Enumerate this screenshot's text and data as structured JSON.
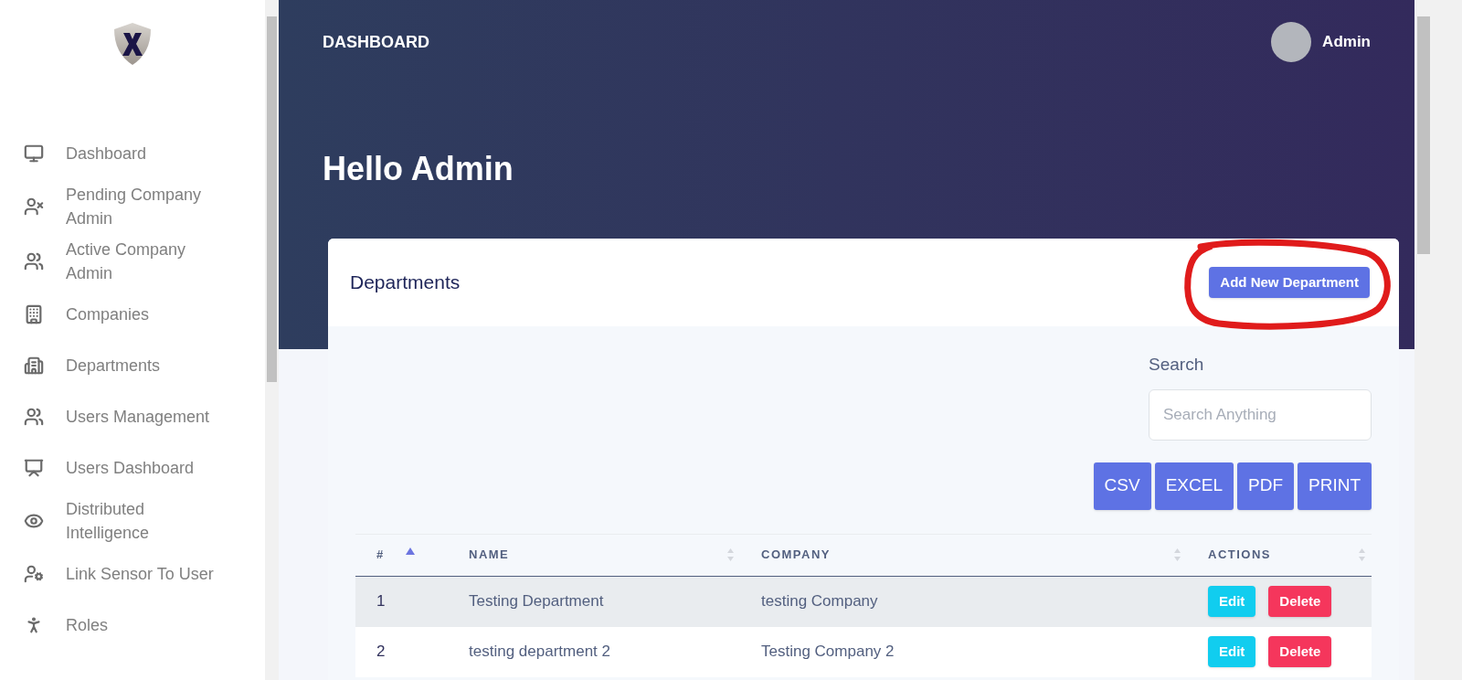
{
  "sidebar": {
    "items": [
      {
        "label": "Dashboard"
      },
      {
        "label": "Pending Company Admin"
      },
      {
        "label": "Active Company Admin"
      },
      {
        "label": "Companies"
      },
      {
        "label": "Departments"
      },
      {
        "label": "Users Management"
      },
      {
        "label": "Users Dashboard"
      },
      {
        "label": "Distributed Intelligence"
      },
      {
        "label": "Link Sensor To User"
      },
      {
        "label": "Roles"
      }
    ]
  },
  "header": {
    "title": "DASHBOARD",
    "user": "Admin"
  },
  "greeting": "Hello Admin",
  "card": {
    "title": "Departments",
    "add_button": "Add New Department",
    "search": {
      "label": "Search",
      "placeholder": "Search Anything"
    },
    "export_buttons": [
      "CSV",
      "EXCEL",
      "PDF",
      "PRINT"
    ],
    "table": {
      "columns": [
        {
          "label": "#",
          "sorted": true
        },
        {
          "label": "NAME",
          "sorted": false
        },
        {
          "label": "COMPANY",
          "sorted": false
        },
        {
          "label": "ACTIONS",
          "sorted": false
        }
      ],
      "rows": [
        {
          "cells": [
            "1",
            "Testing Department",
            "testing Company"
          ],
          "selected": true,
          "actions": [
            "Edit",
            "Delete"
          ]
        },
        {
          "cells": [
            "2",
            "testing department 2",
            "Testing Company 2"
          ],
          "selected": false,
          "actions": [
            "Edit",
            "Delete"
          ]
        }
      ]
    }
  }
}
